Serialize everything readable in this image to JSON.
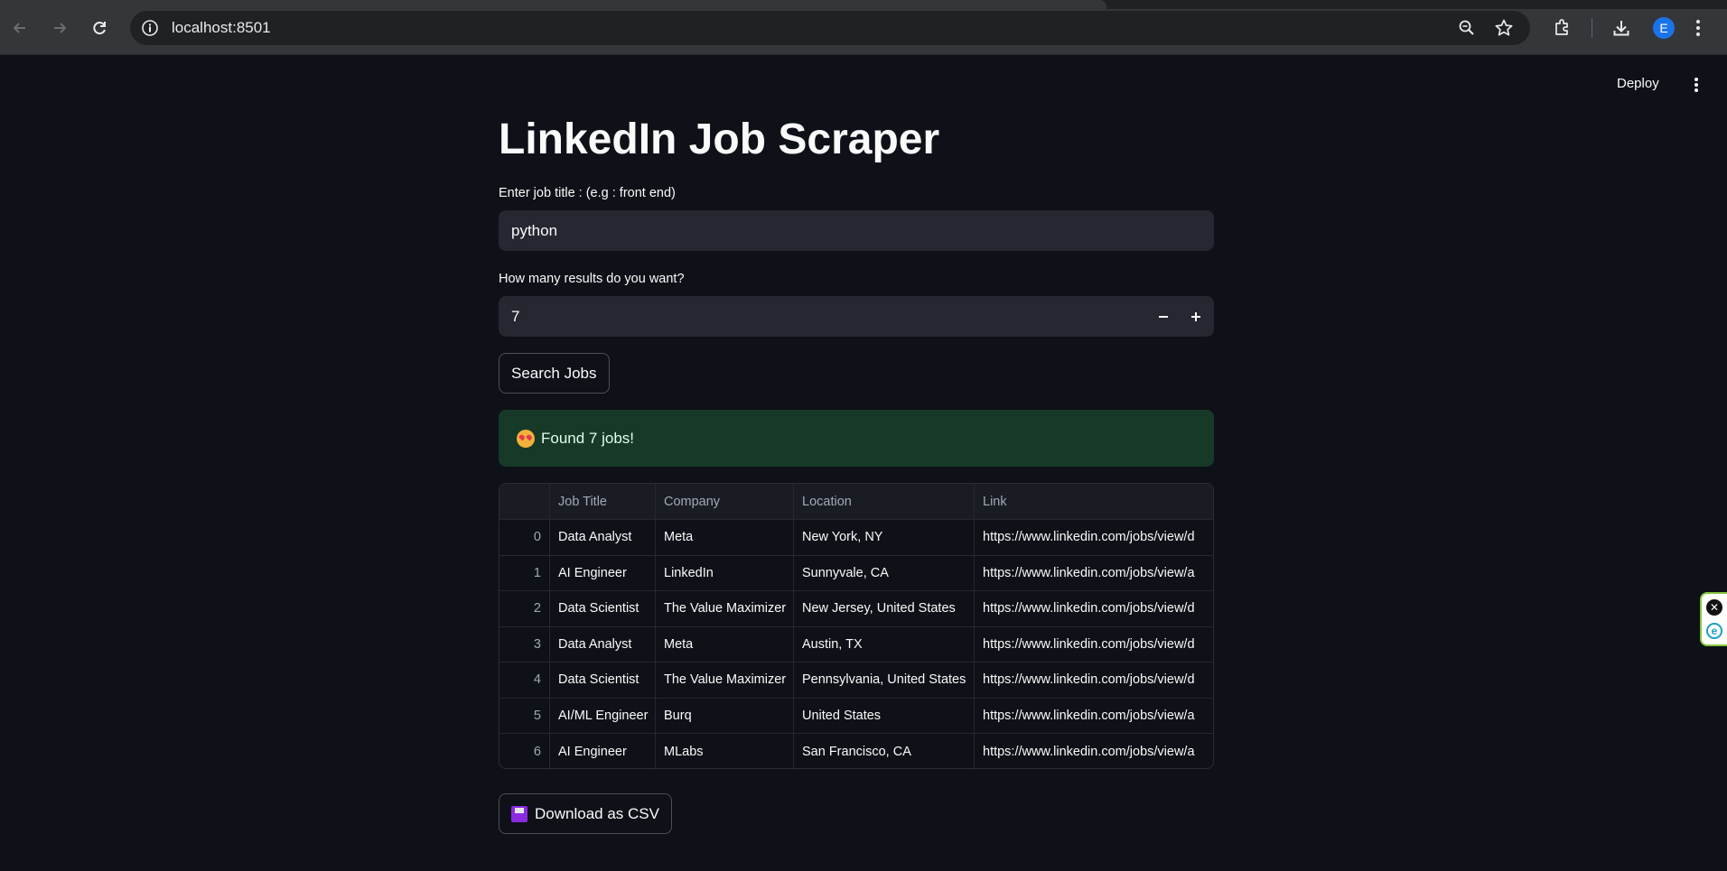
{
  "browser": {
    "url": "localhost:8501",
    "avatar_initial": "E"
  },
  "header": {
    "deploy_label": "Deploy"
  },
  "app": {
    "title": "LinkedIn Job Scraper",
    "job_title_label": "Enter job title : (e.g : front end)",
    "job_title_value": "python",
    "results_label": "How many results do you want?",
    "results_value": "7",
    "search_button": "Search Jobs",
    "success_message": "Found 7 jobs!",
    "download_button": "Download as CSV"
  },
  "table": {
    "columns": [
      "",
      "Job Title",
      "Company",
      "Location",
      "Link"
    ],
    "rows": [
      {
        "index": "0",
        "title": "Data Analyst",
        "company": "Meta",
        "location": "New York, NY",
        "link": "https://www.linkedin.com/jobs/view/d"
      },
      {
        "index": "1",
        "title": "AI Engineer",
        "company": "LinkedIn",
        "location": "Sunnyvale, CA",
        "link": "https://www.linkedin.com/jobs/view/a"
      },
      {
        "index": "2",
        "title": "Data Scientist",
        "company": "The Value Maximizer",
        "location": "New Jersey, United States",
        "link": "https://www.linkedin.com/jobs/view/d"
      },
      {
        "index": "3",
        "title": "Data Analyst",
        "company": "Meta",
        "location": "Austin, TX",
        "link": "https://www.linkedin.com/jobs/view/d"
      },
      {
        "index": "4",
        "title": "Data Scientist",
        "company": "The Value Maximizer",
        "location": "Pennsylvania, United States",
        "link": "https://www.linkedin.com/jobs/view/d"
      },
      {
        "index": "5",
        "title": "AI/ML Engineer",
        "company": "Burq",
        "location": "United States",
        "link": "https://www.linkedin.com/jobs/view/a"
      },
      {
        "index": "6",
        "title": "AI Engineer",
        "company": "MLabs",
        "location": "San Francisco, CA",
        "link": "https://www.linkedin.com/jobs/view/a"
      }
    ]
  },
  "colors": {
    "page_bg": "#0e1117",
    "input_bg": "#262730",
    "success_bg": "#173928",
    "success_text": "#dffde9"
  },
  "icons": [
    "back-arrow-icon",
    "forward-arrow-icon",
    "reload-icon",
    "site-info-icon",
    "zoom-icon",
    "bookmark-star-icon",
    "extensions-icon",
    "download-icon",
    "kebab-menu-icon",
    "star-struck-emoji-icon",
    "floppy-disk-emoji-icon",
    "close-icon",
    "extension-e-icon"
  ]
}
